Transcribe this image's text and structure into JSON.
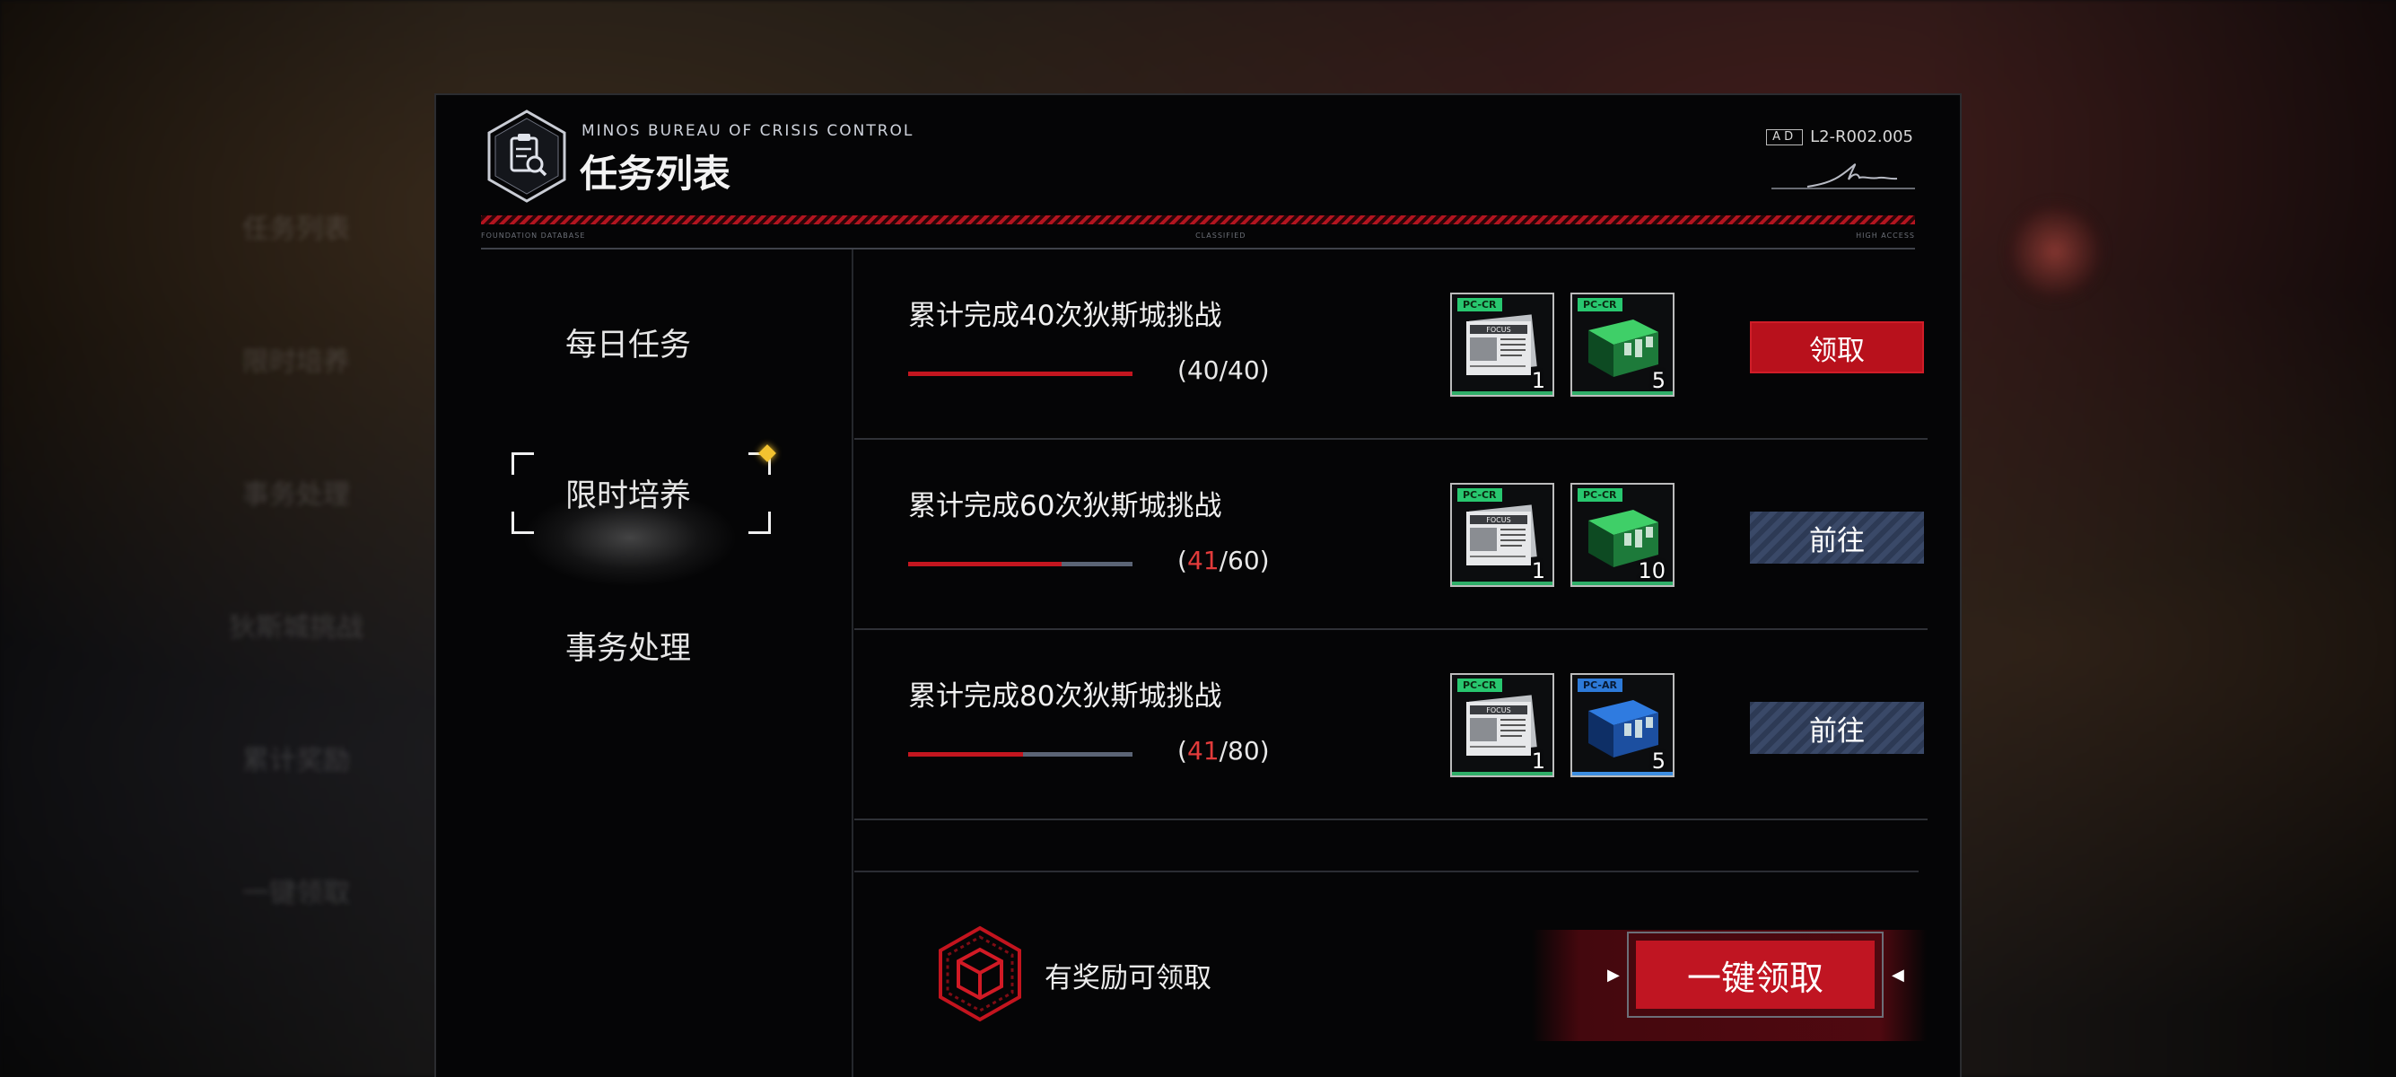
{
  "panel": {
    "org": "MINOS BUREAU OF CRISIS CONTROL",
    "title": "任务列表",
    "code_box": "AD",
    "code": "L2-R002.005",
    "micro": [
      "FOUNDATION DATABASE",
      "CLASSIFIED",
      "HIGH ACCESS"
    ]
  },
  "sidebar": {
    "items": [
      {
        "label": "每日任务",
        "selected": false
      },
      {
        "label": "限时培养",
        "selected": true
      },
      {
        "label": "事务处理",
        "selected": false
      }
    ]
  },
  "tasks": [
    {
      "name": "累计完成40次狄斯城挑战",
      "progress": {
        "current": "40",
        "total": "40",
        "fraction": 1.0,
        "complete": true
      },
      "rewards": [
        {
          "tag": "PC-CR",
          "icon": "election-focus-newspaper",
          "qty": "1",
          "color": "green"
        },
        {
          "tag": "PC-CR",
          "icon": "green-supply-crate",
          "qty": "5",
          "color": "green"
        }
      ],
      "action": "领取"
    },
    {
      "name": "累计完成60次狄斯城挑战",
      "progress": {
        "current": "41",
        "total": "60",
        "fraction": 0.683,
        "complete": false
      },
      "rewards": [
        {
          "tag": "PC-CR",
          "icon": "election-focus-newspaper",
          "qty": "1",
          "color": "green"
        },
        {
          "tag": "PC-CR",
          "icon": "green-supply-crate",
          "qty": "10",
          "color": "green"
        }
      ],
      "action": "前往"
    },
    {
      "name": "累计完成80次狄斯城挑战",
      "progress": {
        "current": "41",
        "total": "80",
        "fraction": 0.5125,
        "complete": false
      },
      "rewards": [
        {
          "tag": "PC-CR",
          "icon": "election-focus-newspaper",
          "qty": "1",
          "color": "green"
        },
        {
          "tag": "PC-AR",
          "icon": "blue-supply-crate",
          "qty": "5",
          "color": "blue"
        }
      ],
      "action": "前往"
    }
  ],
  "footer": {
    "status": "有奖励可领取",
    "claim_all": "一键领取"
  },
  "colors": {
    "accent_red": "#c01522",
    "go_blue": "#3a4968",
    "reward_green": "#28c76f",
    "reward_blue": "#2d7ad8"
  },
  "background_menu": [
    "任务列表",
    "限时培养",
    "事务处理",
    "狄斯城挑战",
    "累计奖励",
    "一键领取"
  ]
}
